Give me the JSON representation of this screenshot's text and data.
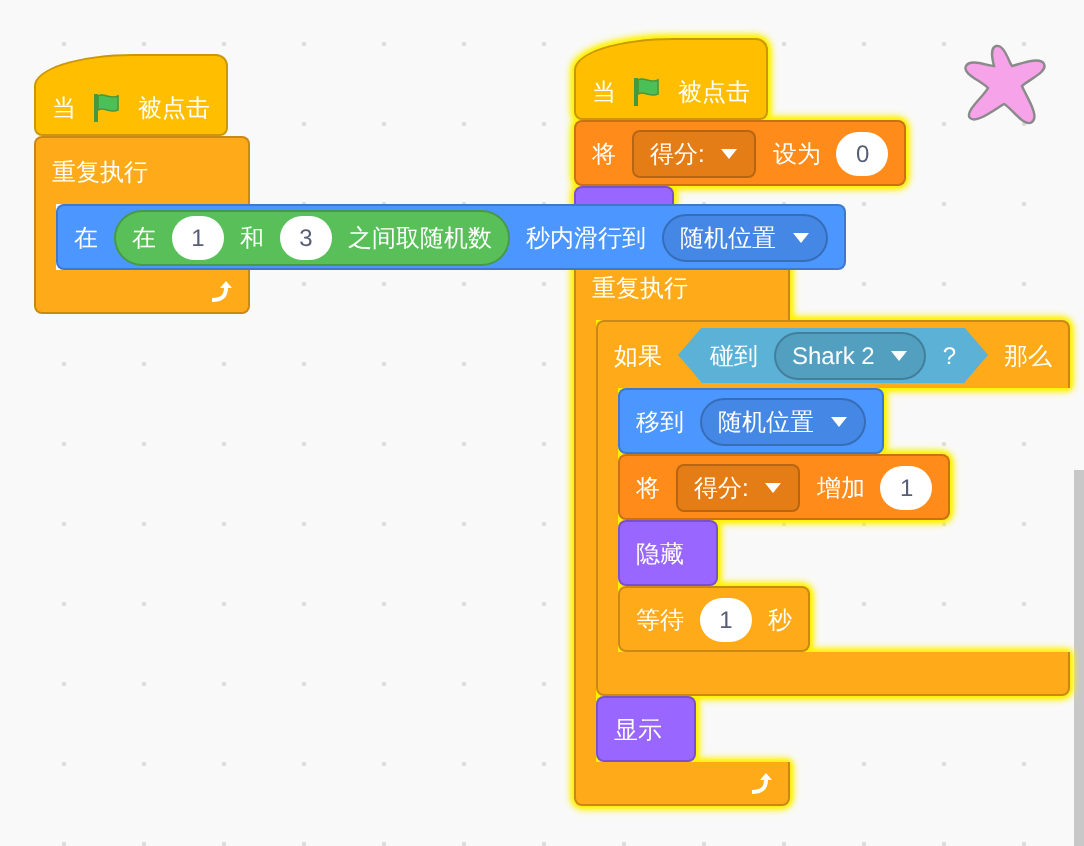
{
  "scripts": [
    {
      "glowing": false,
      "blocks": [
        {
          "kind": "hat",
          "color": "#ffbf00",
          "parts": [
            {
              "kind": "text",
              "text": "当"
            },
            {
              "kind": "flag"
            },
            {
              "kind": "text",
              "text": "被点击"
            }
          ]
        },
        {
          "kind": "forever",
          "color": "#ffab19",
          "parts": [
            {
              "kind": "text",
              "text": "重复执行"
            }
          ],
          "children": [
            {
              "kind": "stack",
              "color": "#4c97ff",
              "parts": [
                {
                  "kind": "text",
                  "text": "在"
                },
                {
                  "kind": "reporter",
                  "color": "#59c059",
                  "parts": [
                    {
                      "kind": "text",
                      "text": "在"
                    },
                    {
                      "kind": "number",
                      "text": "1"
                    },
                    {
                      "kind": "text",
                      "text": "和"
                    },
                    {
                      "kind": "number",
                      "text": "3"
                    },
                    {
                      "kind": "text",
                      "text": "之间取随机数"
                    }
                  ]
                },
                {
                  "kind": "text",
                  "text": "秒内滑行到"
                },
                {
                  "kind": "dropdown",
                  "text": "随机位置"
                }
              ]
            }
          ]
        }
      ]
    },
    {
      "glowing": true,
      "blocks": [
        {
          "kind": "hat",
          "color": "#ffbf00",
          "parts": [
            {
              "kind": "text",
              "text": "当"
            },
            {
              "kind": "flag"
            },
            {
              "kind": "text",
              "text": "被点击"
            }
          ]
        },
        {
          "kind": "stack",
          "color": "#ff8c1a",
          "parts": [
            {
              "kind": "text",
              "text": "将"
            },
            {
              "kind": "variable_dropdown",
              "text": "得分:"
            },
            {
              "kind": "text",
              "text": "设为"
            },
            {
              "kind": "number",
              "text": "0"
            }
          ]
        },
        {
          "kind": "stack",
          "color": "#9966ff"
        },
        {
          "kind": "forever",
          "color": "#ffab19",
          "parts": [
            {
              "kind": "text",
              "text": "重复执行"
            }
          ],
          "children": [
            {
              "kind": "if",
              "color": "#ffab19",
              "parts": [
                {
                  "kind": "text",
                  "text": "如果"
                },
                {
                  "kind": "boolean",
                  "color": "#5cb1d6",
                  "parts": [
                    {
                      "kind": "text",
                      "text": "碰到"
                    },
                    {
                      "kind": "dropdown",
                      "text": "Shark 2"
                    },
                    {
                      "kind": "text",
                      "text": "?"
                    }
                  ]
                },
                {
                  "kind": "text",
                  "text": "那么"
                }
              ],
              "children": [
                {
                  "kind": "stack",
                  "color": "#4c97ff",
                  "parts": [
                    {
                      "kind": "text",
                      "text": "移到"
                    },
                    {
                      "kind": "dropdown",
                      "text": "随机位置"
                    }
                  ]
                },
                {
                  "kind": "stack",
                  "color": "#ff8c1a",
                  "parts": [
                    {
                      "kind": "text",
                      "text": "将"
                    },
                    {
                      "kind": "variable_dropdown",
                      "text": "得分:"
                    },
                    {
                      "kind": "text",
                      "text": "增加"
                    },
                    {
                      "kind": "number",
                      "text": "1"
                    }
                  ]
                },
                {
                  "kind": "stack",
                  "color": "#9966ff",
                  "parts": [
                    {
                      "kind": "text",
                      "text": "隐藏"
                    }
                  ]
                },
                {
                  "kind": "stack",
                  "color": "#ffab19",
                  "parts": [
                    {
                      "kind": "text",
                      "text": "等待"
                    },
                    {
                      "kind": "number",
                      "text": "1"
                    },
                    {
                      "kind": "text",
                      "text": "秒"
                    }
                  ]
                }
              ]
            },
            {
              "kind": "stack",
              "color": "#9966ff",
              "parts": [
                {
                  "kind": "text",
                  "text": "显示"
                }
              ]
            }
          ]
        }
      ]
    }
  ]
}
